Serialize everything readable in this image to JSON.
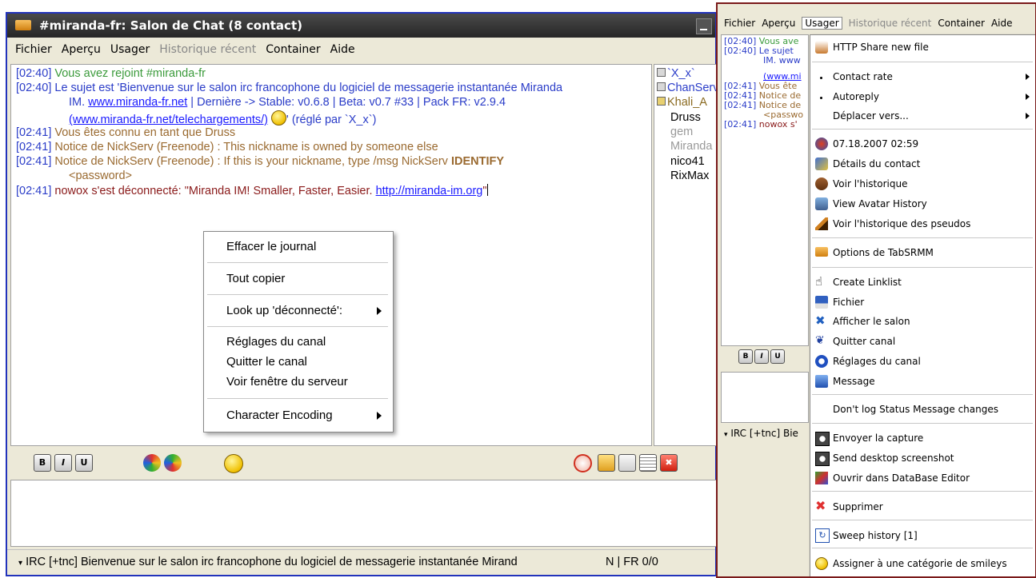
{
  "left": {
    "title": "#miranda-fr: Salon de Chat (8 contact)",
    "menu": [
      {
        "label": "Fichier",
        "disabled": false
      },
      {
        "label": "Aperçu",
        "disabled": false
      },
      {
        "label": "Usager",
        "disabled": false
      },
      {
        "label": "Historique récent",
        "disabled": true
      },
      {
        "label": "Container",
        "disabled": false
      },
      {
        "label": "Aide",
        "disabled": false
      }
    ],
    "log": {
      "l1_ts": "[02:40]",
      "l1_text": "Vous avez rejoint #miranda-fr",
      "l2_ts": "[02:40]",
      "l2_text": "Le sujet est 'Bienvenue sur le salon irc francophone du logiciel de messagerie instantanée Miranda",
      "l2b_link": "www.miranda-fr.net",
      "l2b_text": " | Dernière -> Stable: v0.6.8 | Beta: v0.7 #33 | Pack FR: v2.9.4",
      "l2b_pre": "IM. ",
      "l2c_link": "(www.miranda-fr.net/telechargements/)",
      "l2c_text": "' (réglé par `X_x`)",
      "l3_ts": "[02:41]",
      "l3_text": "Vous êtes connu en tant que Druss",
      "l4_ts": "[02:41]",
      "l4_text": "Notice de NickServ (Freenode) : This nickname is owned by someone else",
      "l5_ts": "[02:41]",
      "l5_text": "Notice de NickServ (Freenode) : If this is your nickname, type /msg NickServ ",
      "l5_bold": "IDENTIFY",
      "l5b_text": "<password>",
      "l6_ts": "[02:41]",
      "l6_text": "nowox s'est déconnecté: \"Miranda IM! Smaller, Faster, Easier. ",
      "l6_link": "http://miranda-im.org",
      "l6_end": "\""
    },
    "users": [
      {
        "name": "`X_x`",
        "kind": "op"
      },
      {
        "name": "ChanServ",
        "kind": "op"
      },
      {
        "name": "Khali_A",
        "kind": "voice"
      },
      {
        "name": "Druss",
        "kind": "normal"
      },
      {
        "name": "gem",
        "kind": "dim"
      },
      {
        "name": "Miranda",
        "kind": "dim"
      },
      {
        "name": "nico41",
        "kind": "normal"
      },
      {
        "name": "RixMax",
        "kind": "normal"
      }
    ],
    "context_menu": {
      "clear": "Effacer le journal",
      "copy_all": "Tout copier",
      "lookup": "Look up 'déconnecté':",
      "channel_settings": "Réglages du canal",
      "leave": "Quitter le canal",
      "server_window": "Voir fenêtre du serveur",
      "encoding": "Character Encoding"
    },
    "status": "IRC [+tnc] Bienvenue sur le salon irc francophone du logiciel de messagerie instantanée Mirand",
    "status_right": "N | FR 0/0"
  },
  "right": {
    "menu": [
      {
        "label": "Fichier",
        "disabled": false
      },
      {
        "label": "Aperçu",
        "disabled": false
      },
      {
        "label": "Usager",
        "disabled": false
      },
      {
        "label": "Historique récent",
        "disabled": true
      },
      {
        "label": "Container",
        "disabled": false
      },
      {
        "label": "Aide",
        "disabled": false
      }
    ],
    "log": {
      "l1_ts": "[02:40]",
      "l1_text": "Vous ave",
      "l2_ts": "[02:40]",
      "l2_text": "Le sujet",
      "l2b": "IM. www",
      "l2c": "(www.mi",
      "l3_ts": "[02:41]",
      "l3_text": "Vous ête",
      "l4_ts": "[02:41]",
      "l4_text": "Notice de",
      "l5_ts": "[02:41]",
      "l5_text": "Notice de",
      "l5b": "<passwo",
      "l6_ts": "[02:41]",
      "l6_text": "nowox s'"
    },
    "status": "IRC [+tnc] Bie",
    "context_menu": {
      "http_share": "HTTP Share new file",
      "contact_rate": "Contact rate",
      "autoreply": "Autoreply",
      "move_to": "Déplacer vers...",
      "date": "07.18.2007 02:59",
      "contact_details": "Détails du contact",
      "view_history": "Voir l'historique",
      "avatar_history": "View Avatar History",
      "nick_history": "Voir l'historique des pseudos",
      "tabsrmm_options": "Options de TabSRMM",
      "create_linklist": "Create Linklist",
      "file": "Fichier",
      "show_channel": "Afficher le salon",
      "leave_channel": "Quitter canal",
      "channel_settings": "Réglages du canal",
      "message": "Message",
      "dont_log": "Don't log Status Message changes",
      "send_capture": "Envoyer la capture",
      "send_desktop": "Send desktop screenshot",
      "open_dbeditor": "Ouvrir dans DataBase Editor",
      "delete": "Supprimer",
      "sweep_history": "Sweep history [1]",
      "assign_smiley": "Assigner à une catégorie de smileys"
    }
  },
  "colors": {
    "left_border": "#2233bb",
    "right_border": "#7a1a1a",
    "timestamp": "#2a3cc8",
    "join_text": "#3a9a3a",
    "notice_text": "#9a6a30",
    "link": "#1a1aff"
  },
  "icons": {
    "bold": "B",
    "italic": "I",
    "underline": "U"
  }
}
